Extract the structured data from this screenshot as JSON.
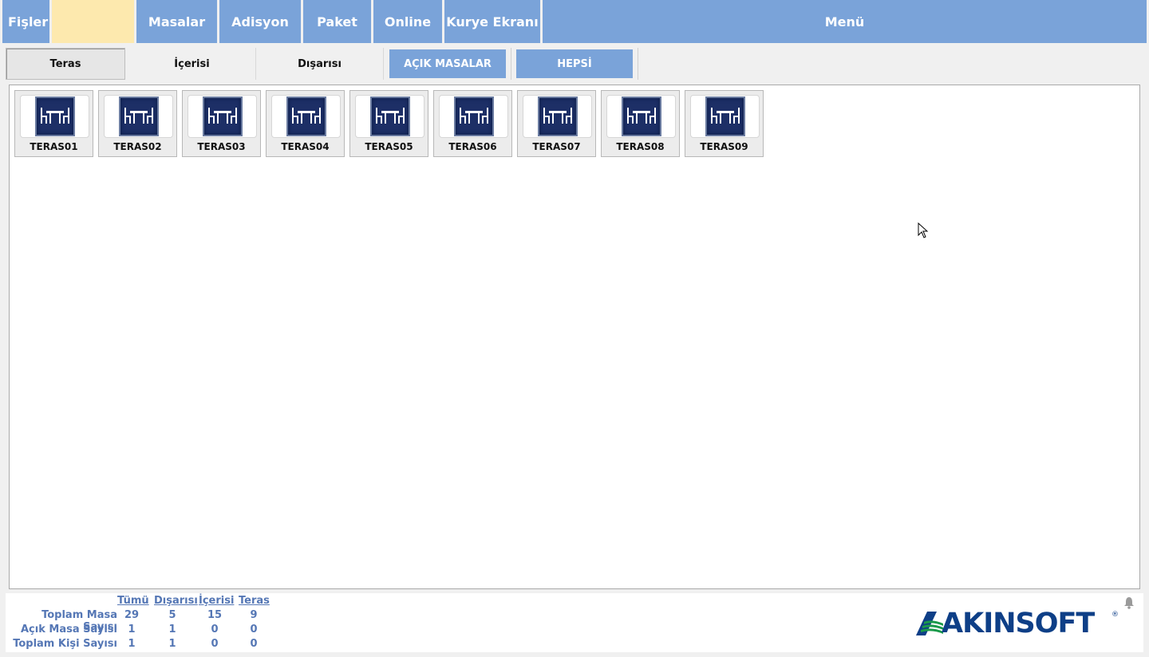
{
  "nav": {
    "fisler": "Fişler",
    "active_tab": "",
    "masalar": "Masalar",
    "adisyon": "Adisyon",
    "paket": "Paket",
    "online": "Online",
    "kurye": "Kurye Ekranı",
    "menu": "Menü"
  },
  "areas": {
    "teras": "Teras",
    "icerisi": "İçerisi",
    "disarisi": "Dışarısı",
    "acik_masalar": "AÇIK MASALAR",
    "hepsi": "HEPSİ"
  },
  "tables": [
    {
      "label": "TERAS01"
    },
    {
      "label": "TERAS02"
    },
    {
      "label": "TERAS03"
    },
    {
      "label": "TERAS04"
    },
    {
      "label": "TERAS05"
    },
    {
      "label": "TERAS06"
    },
    {
      "label": "TERAS07"
    },
    {
      "label": "TERAS08"
    },
    {
      "label": "TERAS09"
    }
  ],
  "stats": {
    "columns": [
      "Tümü",
      "Dışarısı",
      "İçerisi",
      "Teras"
    ],
    "rows": [
      {
        "label": "Toplam Masa Sayısı",
        "values": [
          "29",
          "5",
          "15",
          "9"
        ]
      },
      {
        "label": "Açık Masa Sayısı",
        "values": [
          "1",
          "1",
          "0",
          "0"
        ]
      },
      {
        "label": "Toplam Kişi Sayısı",
        "values": [
          "1",
          "1",
          "0",
          "0"
        ]
      }
    ]
  },
  "brand": {
    "logo_text": "AKINSOFT",
    "registered": "®"
  },
  "colors": {
    "nav_blue": "#7aa3d9",
    "active_yellow": "#fde9ae",
    "stats_blue": "#5577b5",
    "brand_navy": "#0e3f87",
    "brand_green": "#1a9a4a"
  }
}
